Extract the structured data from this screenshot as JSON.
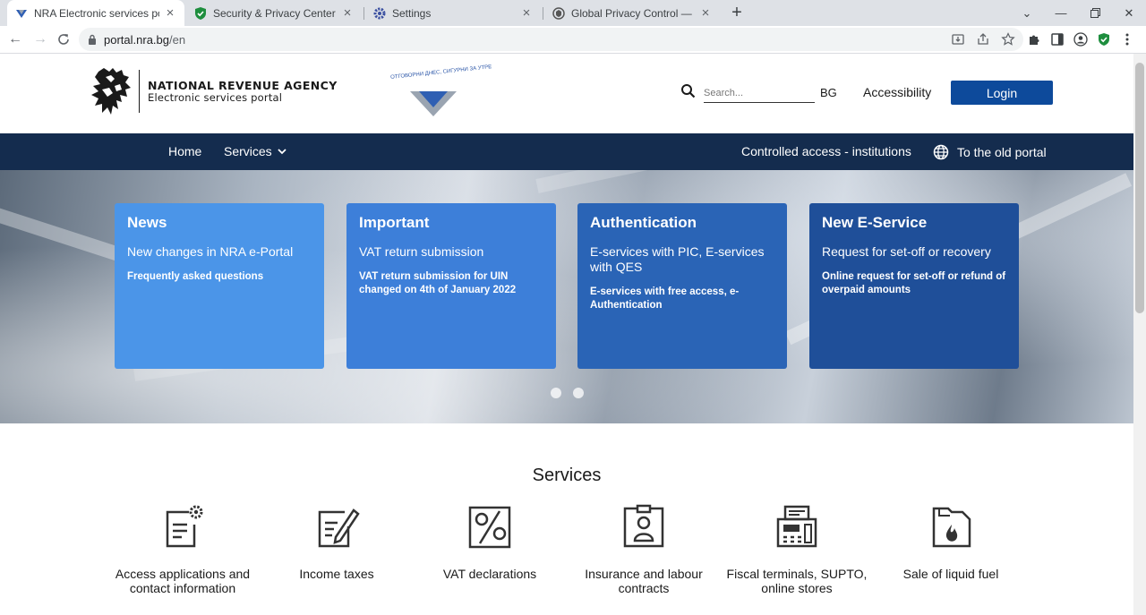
{
  "browser": {
    "tabs": [
      {
        "title": "NRA Electronic services portal",
        "active": true,
        "favicon": "nra-logo-icon"
      },
      {
        "title": "Security & Privacy Center",
        "active": false,
        "favicon": "shield-check-icon"
      },
      {
        "title": "Settings",
        "active": false,
        "favicon": "gear-icon"
      },
      {
        "title": "Global Privacy Control — Take Co",
        "active": false,
        "favicon": "gpc-icon"
      }
    ],
    "url_domain": "portal.nra.bg",
    "url_path": "/en"
  },
  "header": {
    "org_name": "NATIONAL REVENUE AGENCY",
    "portal_name": "Electronic services portal",
    "slogan": "ОТГОВОРНИ ДНЕС, СИГУРНИ ЗА УТРЕ",
    "search_placeholder": "Search...",
    "lang": "BG",
    "accessibility": "Accessibility",
    "login": "Login"
  },
  "nav": {
    "home": "Home",
    "services": "Services",
    "controlled_access": "Controlled access - institutions",
    "old_portal": "To the old portal"
  },
  "hero": {
    "cards": [
      {
        "title": "News",
        "lead": "New changes in NRA e-Portal",
        "desc": "Frequently asked questions"
      },
      {
        "title": "Important",
        "lead": "VAT return submission",
        "desc": "VAT return submission for UIN changed on 4th of January 2022"
      },
      {
        "title": "Authentication",
        "lead": "E-services with PIC, E-services with QES",
        "desc": "E-services with free access, e-Authentication"
      },
      {
        "title": "New E-Service",
        "lead": "Request for set-off or recovery",
        "desc": "Online request for set-off or refund of overpaid amounts"
      }
    ],
    "card_colors": [
      "#4b95e8",
      "#3d7fd9",
      "#2a64b6",
      "#1f4f99"
    ],
    "slides": 2
  },
  "services": {
    "title": "Services",
    "items": [
      {
        "label": "Access applications and contact information",
        "icon": "document-gear-icon"
      },
      {
        "label": "Income taxes",
        "icon": "document-pen-icon"
      },
      {
        "label": "VAT declarations",
        "icon": "percent-icon"
      },
      {
        "label": "Insurance and labour contracts",
        "icon": "id-badge-icon"
      },
      {
        "label": "Fiscal terminals, SUPTO, online stores",
        "icon": "cash-register-icon"
      },
      {
        "label": "Sale of liquid fuel",
        "icon": "fuel-canister-icon"
      }
    ]
  }
}
